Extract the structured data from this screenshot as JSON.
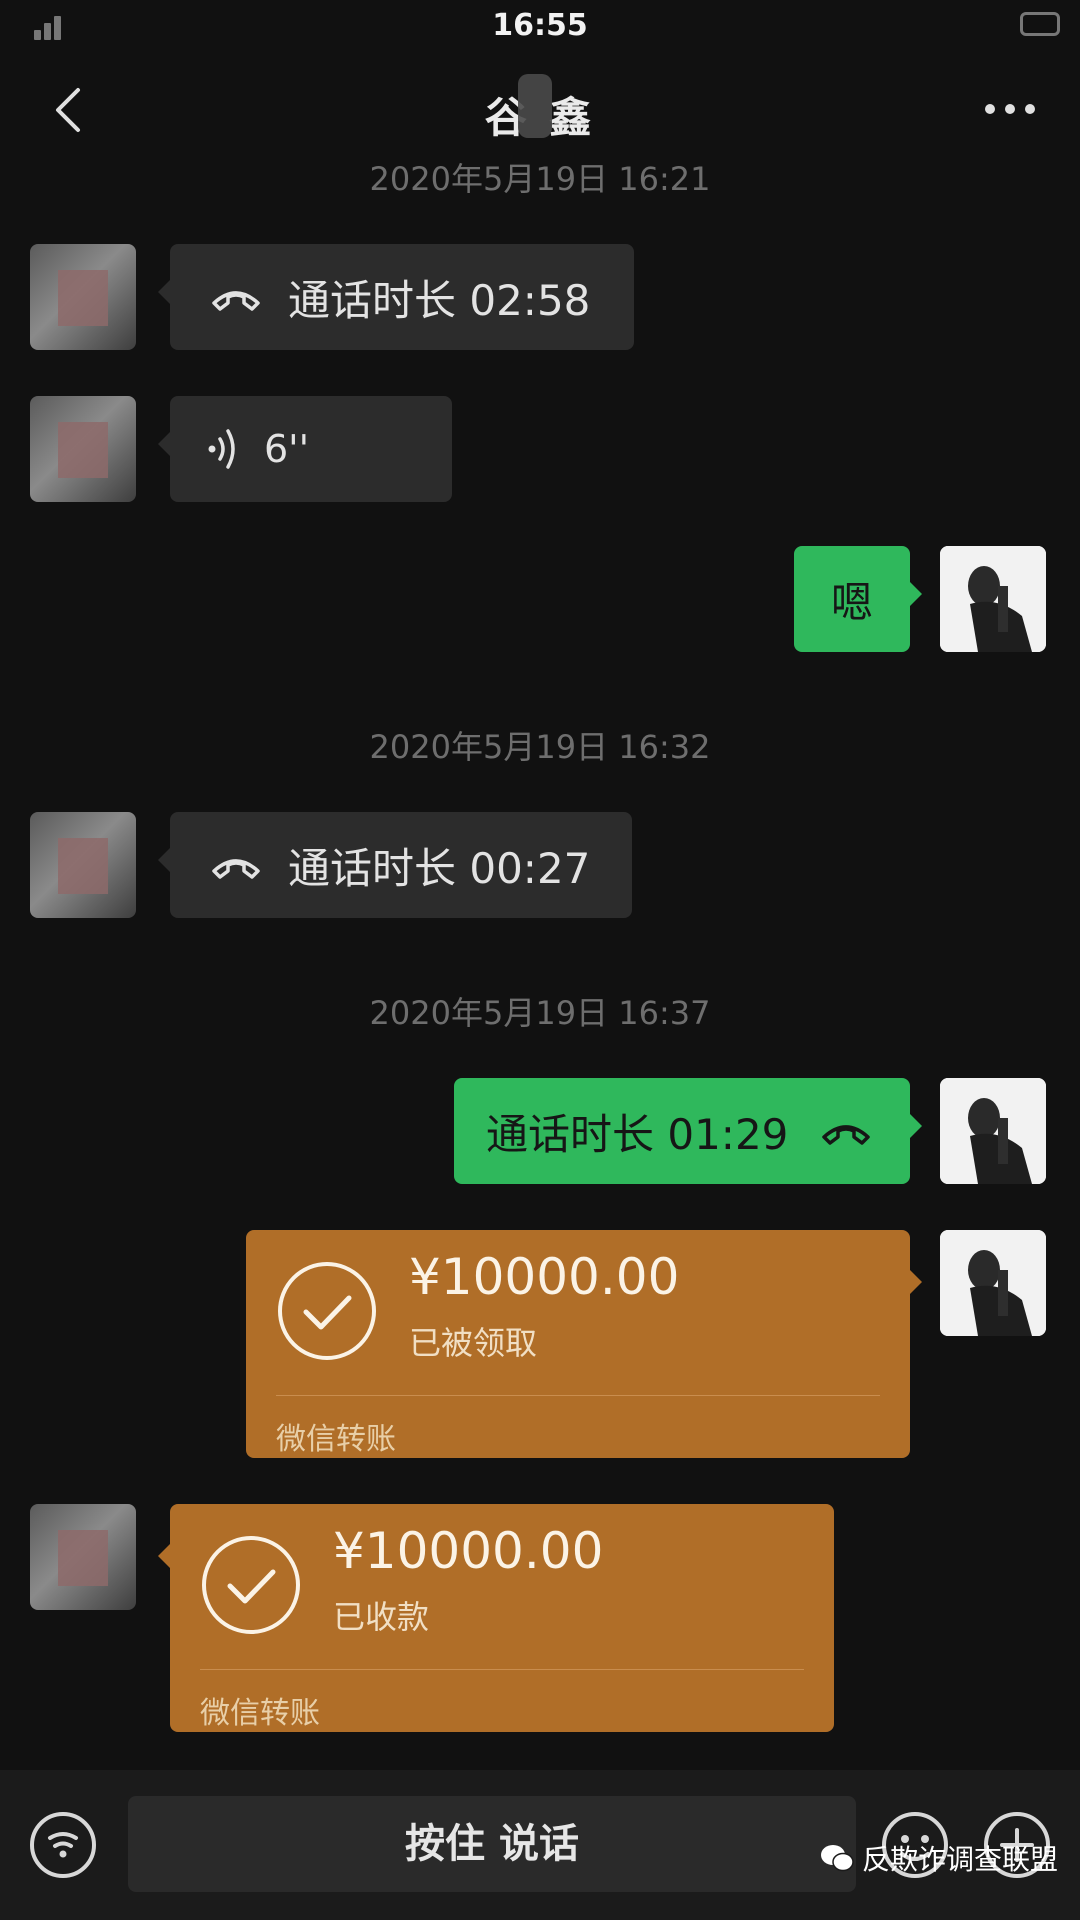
{
  "status_bar": {
    "time": "16:55"
  },
  "header": {
    "title": "谷 鑫"
  },
  "messages": [
    {
      "timestamp": "2020年5月19日 16:21"
    },
    {
      "call_text": "通话时长 02:58"
    },
    {
      "voice_duration": "6''"
    },
    {
      "text": "嗯"
    },
    {
      "timestamp": "2020年5月19日 16:32"
    },
    {
      "call_text": "通话时长 00:27"
    },
    {
      "timestamp": "2020年5月19日 16:37"
    },
    {
      "call_text": "通话时长 01:29"
    },
    {
      "amount": "¥10000.00",
      "status": "已被领取",
      "label": "微信转账"
    },
    {
      "amount": "¥10000.00",
      "status": "已收款",
      "label": "微信转账"
    }
  ],
  "input_bar": {
    "hold_to_talk": "按住 说话"
  },
  "watermark": {
    "text": "反欺诈调查联盟"
  },
  "colors": {
    "background": "#111111",
    "green_bubble": "#2fb85c",
    "transfer_orange": "#b06e28"
  }
}
